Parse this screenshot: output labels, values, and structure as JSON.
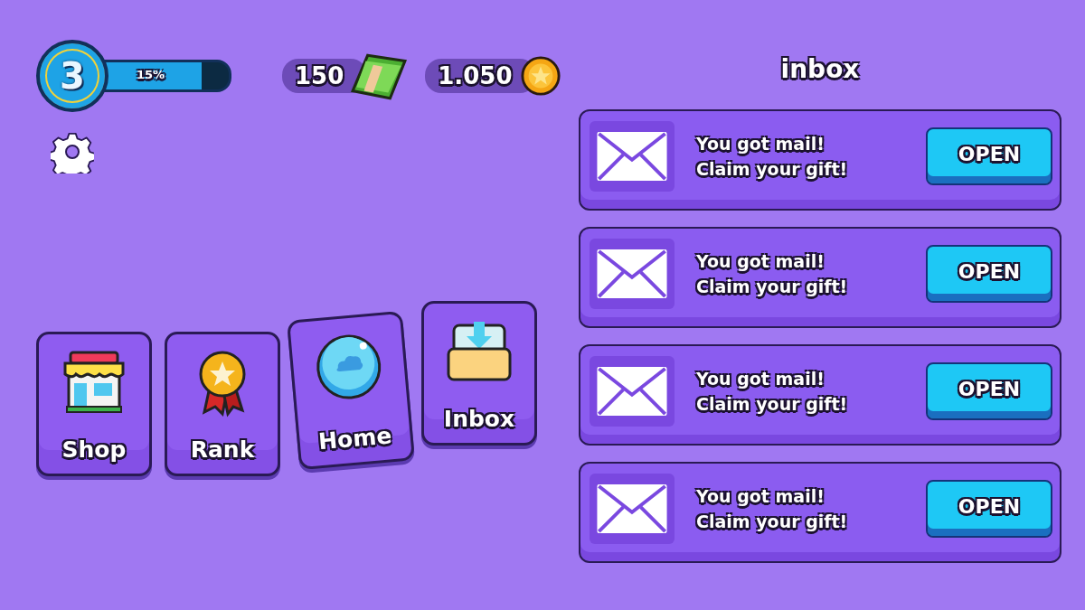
{
  "player": {
    "level_number": "3",
    "xp": {
      "level": 0.78,
      "reading": "15%"
    }
  },
  "currencies": [
    {
      "kind": "cash",
      "amount": "150"
    },
    {
      "kind": "coin",
      "amount": "1.050"
    }
  ],
  "nav": [
    {
      "kind": "shop",
      "label": "Shop",
      "selected": false
    },
    {
      "kind": "rank",
      "label": "Rank",
      "selected": false
    },
    {
      "kind": "home",
      "label": "Home",
      "selected": true
    },
    {
      "kind": "inbox",
      "label": "Inbox",
      "selected": false
    }
  ],
  "inbox": {
    "title": "inbox",
    "messages": [
      {
        "title": "You got mail!",
        "body": "Claim your gift!",
        "button": "OPEN"
      },
      {
        "title": "You got mail!",
        "body": "Claim your gift!",
        "button": "OPEN"
      },
      {
        "title": "You got mail!",
        "body": "Claim your gift!",
        "button": "OPEN"
      },
      {
        "title": "You got mail!",
        "body": "Claim your gift!",
        "button": "OPEN"
      }
    ]
  }
}
